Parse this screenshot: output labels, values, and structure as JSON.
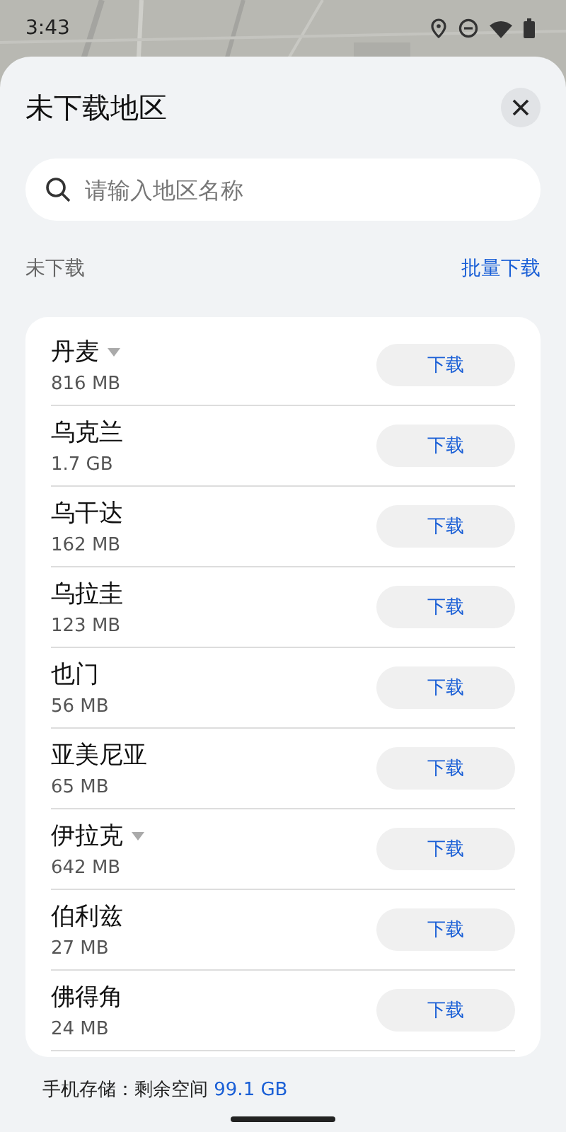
{
  "status_bar": {
    "time": "3:43"
  },
  "sheet": {
    "title": "未下载地区",
    "search": {
      "placeholder": "请输入地区名称"
    },
    "section_label": "未下载",
    "batch_action": "批量下载",
    "regions": [
      {
        "name": "丹麦",
        "size": "816 MB",
        "expandable": true,
        "action": "下载"
      },
      {
        "name": "乌克兰",
        "size": "1.7 GB",
        "expandable": false,
        "action": "下载"
      },
      {
        "name": "乌干达",
        "size": "162 MB",
        "expandable": false,
        "action": "下载"
      },
      {
        "name": "乌拉圭",
        "size": "123 MB",
        "expandable": false,
        "action": "下载"
      },
      {
        "name": "也门",
        "size": "56 MB",
        "expandable": false,
        "action": "下载"
      },
      {
        "name": "亚美尼亚",
        "size": "65 MB",
        "expandable": false,
        "action": "下载"
      },
      {
        "name": "伊拉克",
        "size": "642 MB",
        "expandable": true,
        "action": "下载"
      },
      {
        "name": "伯利兹",
        "size": "27 MB",
        "expandable": false,
        "action": "下载"
      },
      {
        "name": "佛得角",
        "size": "24 MB",
        "expandable": false,
        "action": "下载"
      }
    ],
    "storage": {
      "label": "手机存储：剩余空间 ",
      "free": "99.1 GB"
    }
  }
}
